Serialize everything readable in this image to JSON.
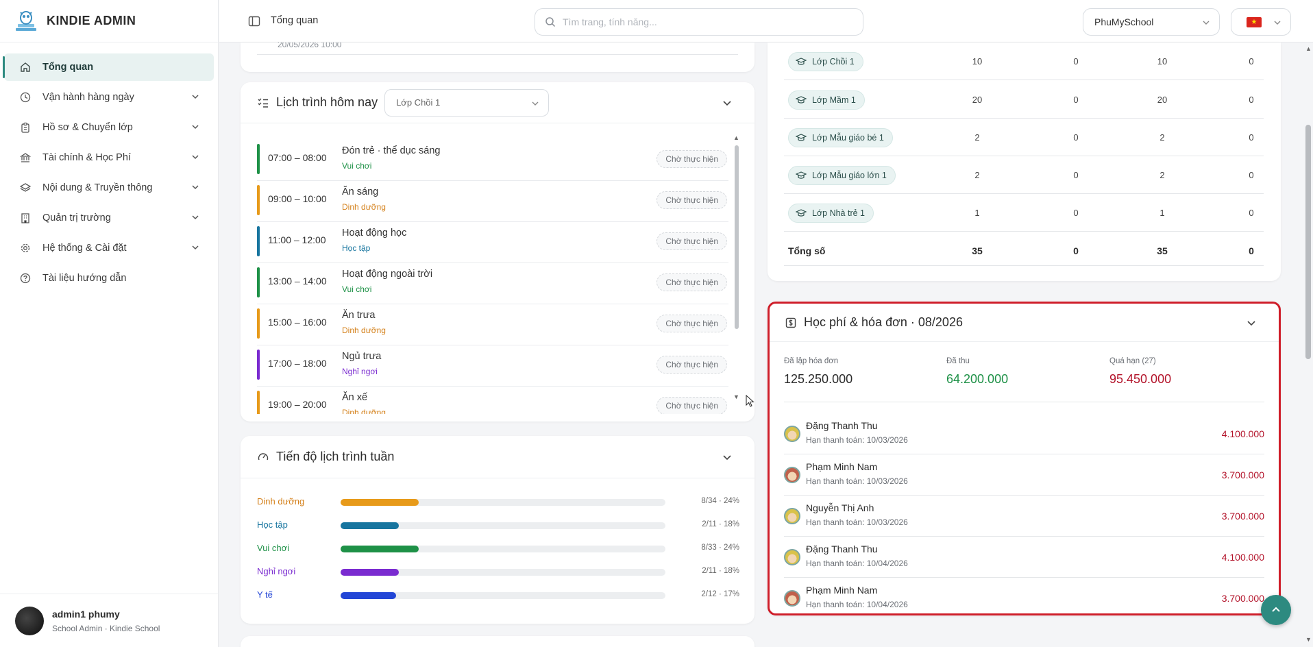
{
  "app": {
    "brand": "KINDIE ADMIN"
  },
  "sidebar": {
    "items": [
      {
        "label": "Tổng quan",
        "icon": "home-icon",
        "active": true
      },
      {
        "label": "Vận hành hàng ngày",
        "icon": "clock-icon"
      },
      {
        "label": "Hồ sơ & Chuyển lớp",
        "icon": "clipboard-icon"
      },
      {
        "label": "Tài chính & Học Phí",
        "icon": "bank-icon"
      },
      {
        "label": "Nội dung & Truyền thông",
        "icon": "layers-icon"
      },
      {
        "label": "Quản trị trường",
        "icon": "building-icon"
      },
      {
        "label": "Hệ thống & Cài đặt",
        "icon": "gear-icon"
      },
      {
        "label": "Tài liệu hướng dẫn",
        "icon": "help-icon"
      }
    ],
    "user": {
      "name": "admin1 phumy",
      "role": "School Admin · Kindie School"
    }
  },
  "topbar": {
    "title": "Tổng quan",
    "search_placeholder": "Tìm trang, tính năng...",
    "school": "PhuMySchool",
    "language_flag": "vn-flag-icon"
  },
  "top_card": {
    "cut_date": "20/05/2026 10:00"
  },
  "schedule": {
    "title": "Lịch trình hôm nay",
    "class_select": "Lớp Chồi 1",
    "rows": [
      {
        "time": "07:00 – 08:00",
        "activity": "Đón trẻ · thể dục sáng",
        "category": "Vui chơi",
        "color": "#1e9147",
        "status": "Chờ thực hiện"
      },
      {
        "time": "09:00 – 10:00",
        "activity": "Ăn sáng",
        "category": "Dinh dưỡng",
        "color": "#e79a1a",
        "status": "Chờ thực hiện"
      },
      {
        "time": "11:00 – 12:00",
        "activity": "Hoạt động học",
        "category": "Học tập",
        "color": "#17759f",
        "status": "Chờ thực hiện"
      },
      {
        "time": "13:00 – 14:00",
        "activity": "Hoạt động ngoài trời",
        "category": "Vui chơi",
        "color": "#1e9147",
        "status": "Chờ thực hiện"
      },
      {
        "time": "15:00 – 16:00",
        "activity": "Ăn trưa",
        "category": "Dinh dưỡng",
        "color": "#e79a1a",
        "status": "Chờ thực hiện"
      },
      {
        "time": "17:00 – 18:00",
        "activity": "Ngủ trưa",
        "category": "Nghỉ ngơi",
        "color": "#7a2bd0",
        "status": "Chờ thực hiện"
      },
      {
        "time": "19:00 – 20:00",
        "activity": "Ăn xế",
        "category": "Dinh dưỡng",
        "color": "#e79a1a",
        "status": "Chờ thực hiện"
      }
    ]
  },
  "weekly": {
    "title": "Tiến độ lịch trình tuần",
    "rows": [
      {
        "label": "Dinh dưỡng",
        "value": "8/34 · 24%",
        "fraction": 0.24,
        "color": "#e79a1a",
        "label_color": "#d4801a"
      },
      {
        "label": "Học tập",
        "value": "2/11 · 18%",
        "fraction": 0.18,
        "color": "#17759f",
        "label_color": "#17759f"
      },
      {
        "label": "Vui chơi",
        "value": "8/33 · 24%",
        "fraction": 0.24,
        "color": "#1e9147",
        "label_color": "#1e9147"
      },
      {
        "label": "Nghỉ ngơi",
        "value": "2/11 · 18%",
        "fraction": 0.18,
        "color": "#7a2bd0",
        "label_color": "#7a2bd0"
      },
      {
        "label": "Y tế",
        "value": "2/12 · 17%",
        "fraction": 0.17,
        "color": "#2346d6",
        "label_color": "#2346d6"
      }
    ]
  },
  "class_table": {
    "rows": [
      {
        "class": "Lớp Chồi 1",
        "c1": "10",
        "c2": "0",
        "c3": "10",
        "c4": "0"
      },
      {
        "class": "Lớp Mầm 1",
        "c1": "20",
        "c2": "0",
        "c3": "20",
        "c4": "0"
      },
      {
        "class": "Lớp Mẫu giáo bé 1",
        "c1": "2",
        "c2": "0",
        "c3": "2",
        "c4": "0"
      },
      {
        "class": "Lớp Mẫu giáo lớn 1",
        "c1": "2",
        "c2": "0",
        "c3": "2",
        "c4": "0"
      },
      {
        "class": "Lớp Nhà trẻ 1",
        "c1": "1",
        "c2": "0",
        "c3": "1",
        "c4": "0"
      }
    ],
    "total": {
      "label": "Tổng số",
      "c1": "35",
      "c2": "0",
      "c3": "35",
      "c4": "0"
    }
  },
  "fees": {
    "title": "Học phí & hóa đơn · 08/2026",
    "stats": [
      {
        "label": "Đã lập hóa đơn",
        "value": "125.250.000",
        "color": "#2b2b2b"
      },
      {
        "label": "Đã thu",
        "value": "64.200.000",
        "color": "#1e9147"
      },
      {
        "label": "Quá hạn (27)",
        "value": "95.450.000",
        "color": "#b3132a"
      }
    ],
    "rows": [
      {
        "name": "Đặng Thanh Thu",
        "due": "Hạn thanh toán: 10/03/2026",
        "amount": "4.100.000",
        "avatar": "#d9c24a"
      },
      {
        "name": "Phạm Minh Nam",
        "due": "Hạn thanh toán: 10/03/2026",
        "amount": "3.700.000",
        "avatar": "#c0604a"
      },
      {
        "name": "Nguyễn Thị Anh",
        "due": "Hạn thanh toán: 10/03/2026",
        "amount": "3.700.000",
        "avatar": "#d9c24a"
      },
      {
        "name": "Đặng Thanh Thu",
        "due": "Hạn thanh toán: 10/04/2026",
        "amount": "4.100.000",
        "avatar": "#d9c24a"
      },
      {
        "name": "Phạm Minh Nam",
        "due": "Hạn thanh toán: 10/04/2026",
        "amount": "3.700.000",
        "avatar": "#c0604a"
      }
    ]
  },
  "colors": {
    "accent": "#2d8a80",
    "highlight_border": "#cf1e2a"
  }
}
